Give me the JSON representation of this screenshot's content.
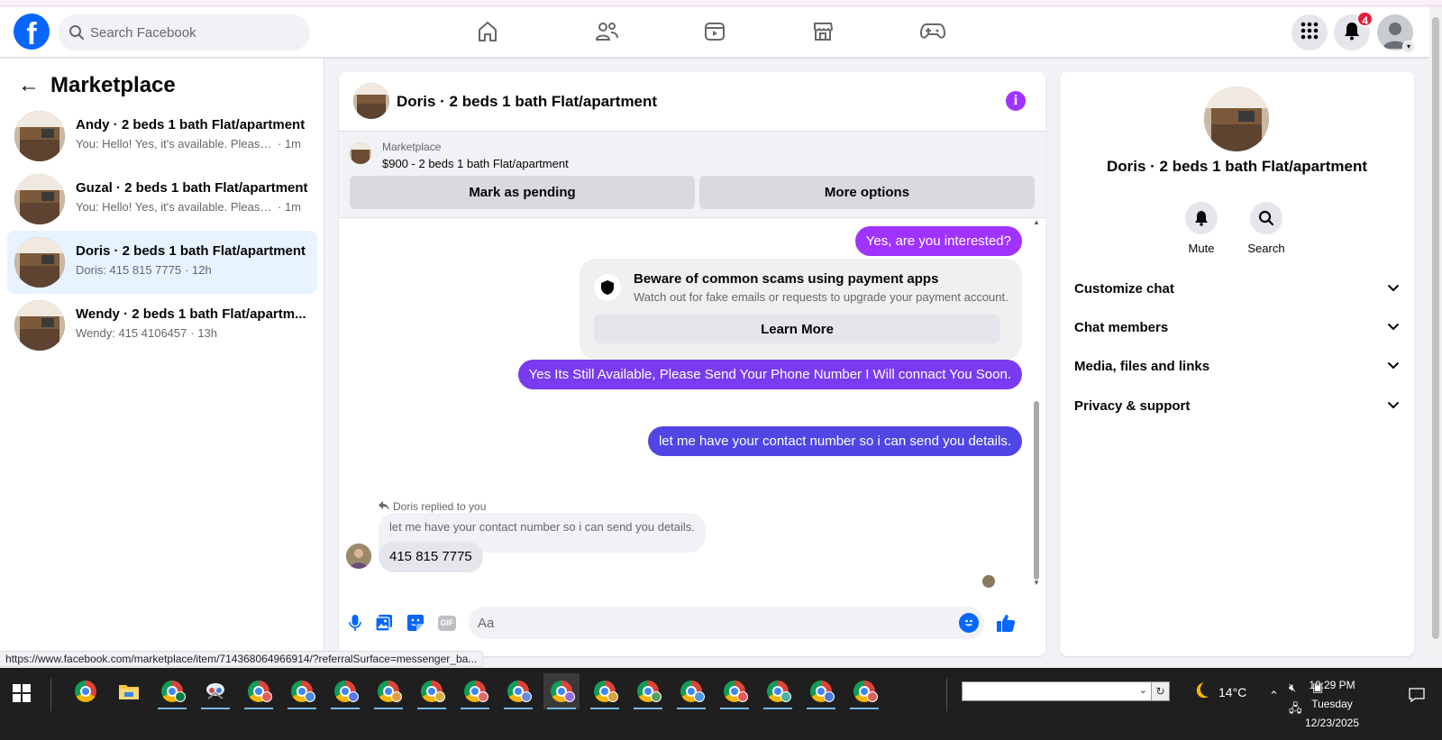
{
  "header": {
    "logo": "f",
    "search_placeholder": "Search Facebook",
    "nav_icons": [
      "home-icon",
      "friends-icon",
      "video-icon",
      "marketplace-icon",
      "gaming-icon"
    ],
    "notifications_count": "4",
    "accent": "#0866ff"
  },
  "sidebar": {
    "back": "←",
    "title": "Marketplace",
    "conversations": [
      {
        "title": "Andy · 2 beds 1 bath Flat/apartment",
        "preview": "You: Hello! Yes, it's available. Please s...",
        "time": "· 1m"
      },
      {
        "title": "Guzal · 2 beds 1 bath Flat/apartment",
        "preview": "You: Hello! Yes, it's available. Please s...",
        "time": "· 1m"
      },
      {
        "title": "Doris · 2 beds 1 bath Flat/apartment",
        "preview": "Doris: 415 815 7775",
        "time": "· 12h"
      },
      {
        "title": "Wendy · 2 beds 1 bath Flat/apartm...",
        "preview": "Wendy: 415 4106457",
        "time": "· 13h"
      }
    ]
  },
  "status_url": "https://www.facebook.com/marketplace/item/714368064966914/?referralSurface=messenger_ba...",
  "chat": {
    "title": "Doris · 2 beds 1 bath Flat/apartment",
    "info": "i",
    "listing": {
      "label": "Marketplace",
      "price_title": "$900 - 2 beds 1 bath Flat/apartment",
      "mark_pending": "Mark as pending",
      "more_options": "More options"
    },
    "messages": {
      "m1": "Yes, are you interested?",
      "scam_title": "Beware of common scams using payment apps",
      "scam_desc": "Watch out for fake emails or requests to upgrade your payment account.",
      "learn_more": "Learn More",
      "m2": "Yes Its Still Available, Please Send Your Phone Number I Will connact You Soon.",
      "m3": "let me have your contact number so i can send you details.",
      "reply_label": "Doris replied to you",
      "quoted": "let me have your contact number so i can send you details.",
      "reply": "415 815 7775"
    },
    "colors": {
      "m1": "#a033ff",
      "m2": "#7a3bf0",
      "m3": "#4f46e5"
    },
    "composer_placeholder": "Aa",
    "gif": "GIF"
  },
  "info_panel": {
    "name": "Doris · 2 beds 1 bath Flat/apartment",
    "mute": "Mute",
    "search": "Search",
    "rows": [
      "Customize chat",
      "Chat members",
      "Media, files and links",
      "Privacy & support"
    ]
  },
  "taskbar": {
    "temperature": "14°C",
    "time": "10:29 PM",
    "day": "Tuesday",
    "date": "12/23/2025"
  }
}
